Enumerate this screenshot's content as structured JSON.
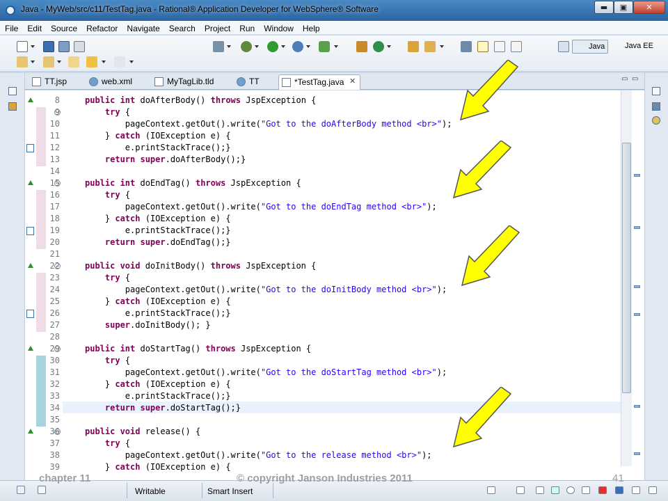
{
  "window": {
    "title": "Java - MyWeb/src/c11/TestTag.java - Rational® Application Developer for WebSphere® Software",
    "min_label": "▬",
    "max_label": "▣",
    "close_label": "✕"
  },
  "menu": [
    "File",
    "Edit",
    "Source",
    "Refactor",
    "Navigate",
    "Search",
    "Project",
    "Run",
    "Window",
    "Help"
  ],
  "perspectives": {
    "java": "Java",
    "javaee": "Java EE"
  },
  "tabs": [
    {
      "label": "TT.jsp",
      "icon": "jsp-file-icon"
    },
    {
      "label": "web.xml",
      "icon": "globe-icon"
    },
    {
      "label": "MyTagLib.tld",
      "icon": "xml-file-icon"
    },
    {
      "label": "TT",
      "icon": "globe-icon"
    },
    {
      "label": "*TestTag.java",
      "icon": "java-file-icon"
    }
  ],
  "tab_close": "✕",
  "tab_min": "▭",
  "tab_max": "▭",
  "code": {
    "line_numbers": [
      "8",
      "9",
      "10",
      "11",
      "12",
      "13",
      "14",
      "15",
      "16",
      "17",
      "18",
      "19",
      "20",
      "21",
      "22",
      "23",
      "24",
      "25",
      "26",
      "27",
      "28",
      "29",
      "30",
      "31",
      "32",
      "33",
      "34",
      "35",
      "36",
      "37",
      "38",
      "39"
    ],
    "lines": [
      [
        {
          "t": "public int ",
          "k": 1
        },
        {
          "t": "doAfterBody() "
        },
        {
          "t": "throws ",
          "k": 1
        },
        {
          "t": "JspException {"
        }
      ],
      [
        {
          "t": "    "
        },
        {
          "t": "try ",
          "k": 1
        },
        {
          "t": "{"
        }
      ],
      [
        {
          "t": "        pageContext.getOut().write("
        },
        {
          "t": "\"Got to the doAfterBody method <br>\"",
          "s": 1
        },
        {
          "t": ");"
        }
      ],
      [
        {
          "t": "    } "
        },
        {
          "t": "catch ",
          "k": 1
        },
        {
          "t": "(IOException e) {"
        }
      ],
      [
        {
          "t": "        e.printStackTrace();}"
        }
      ],
      [
        {
          "t": "    "
        },
        {
          "t": "return super",
          "k": 1
        },
        {
          "t": ".doAfterBody();}"
        }
      ],
      [
        {
          "t": ""
        }
      ],
      [
        {
          "t": "public int ",
          "k": 1
        },
        {
          "t": "doEndTag() "
        },
        {
          "t": "throws ",
          "k": 1
        },
        {
          "t": "JspException {"
        }
      ],
      [
        {
          "t": "    "
        },
        {
          "t": "try ",
          "k": 1
        },
        {
          "t": "{"
        }
      ],
      [
        {
          "t": "        pageContext.getOut().write("
        },
        {
          "t": "\"Got to the doEndTag method <br>\"",
          "s": 1
        },
        {
          "t": ");"
        }
      ],
      [
        {
          "t": "    } "
        },
        {
          "t": "catch ",
          "k": 1
        },
        {
          "t": "(IOException e) {"
        }
      ],
      [
        {
          "t": "        e.printStackTrace();}"
        }
      ],
      [
        {
          "t": "    "
        },
        {
          "t": "return super",
          "k": 1
        },
        {
          "t": ".doEndTag();}"
        }
      ],
      [
        {
          "t": ""
        }
      ],
      [
        {
          "t": "public void ",
          "k": 1
        },
        {
          "t": "doInitBody() "
        },
        {
          "t": "throws ",
          "k": 1
        },
        {
          "t": "JspException {"
        }
      ],
      [
        {
          "t": "    "
        },
        {
          "t": "try ",
          "k": 1
        },
        {
          "t": "{"
        }
      ],
      [
        {
          "t": "        pageContext.getOut().write("
        },
        {
          "t": "\"Got to the doInitBody method <br>\"",
          "s": 1
        },
        {
          "t": ");"
        }
      ],
      [
        {
          "t": "    } "
        },
        {
          "t": "catch ",
          "k": 1
        },
        {
          "t": "(IOException e) {"
        }
      ],
      [
        {
          "t": "        e.printStackTrace();}"
        }
      ],
      [
        {
          "t": "    "
        },
        {
          "t": "super",
          "k": 1
        },
        {
          "t": ".doInitBody(); }"
        }
      ],
      [
        {
          "t": ""
        }
      ],
      [
        {
          "t": "public int ",
          "k": 1
        },
        {
          "t": "doStartTag() "
        },
        {
          "t": "throws ",
          "k": 1
        },
        {
          "t": "JspException {"
        }
      ],
      [
        {
          "t": "    "
        },
        {
          "t": "try ",
          "k": 1
        },
        {
          "t": "{"
        }
      ],
      [
        {
          "t": "        pageContext.getOut().write("
        },
        {
          "t": "\"Got to the doStartTag method <br>\"",
          "s": 1
        },
        {
          "t": ");"
        }
      ],
      [
        {
          "t": "    } "
        },
        {
          "t": "catch ",
          "k": 1
        },
        {
          "t": "(IOException e) {"
        }
      ],
      [
        {
          "t": "        e.printStackTrace();}"
        }
      ],
      [
        {
          "t": "    "
        },
        {
          "t": "return super",
          "k": 1
        },
        {
          "t": ".doStartTag();}"
        }
      ],
      [
        {
          "t": ""
        }
      ],
      [
        {
          "t": "public void ",
          "k": 1
        },
        {
          "t": "release() {"
        }
      ],
      [
        {
          "t": "    "
        },
        {
          "t": "try ",
          "k": 1
        },
        {
          "t": "{"
        }
      ],
      [
        {
          "t": "        pageContext.getOut().write("
        },
        {
          "t": "\"Got to the release method <br>\"",
          "s": 1
        },
        {
          "t": ");"
        }
      ],
      [
        {
          "t": "    } "
        },
        {
          "t": "catch ",
          "k": 1
        },
        {
          "t": "(IOException e) {"
        }
      ]
    ],
    "current_line": "34"
  },
  "status": {
    "writable": "Writable",
    "insert_mode": "Smart Insert"
  },
  "footer": {
    "chapter": "chapter 11",
    "copyright": "© copyright Janson Industries 2011",
    "page": "41"
  },
  "colors": {
    "keyword": "#7f0055",
    "string": "#2a00ff",
    "arrow": "#ffff00",
    "current_line": "#e8f2fe"
  }
}
